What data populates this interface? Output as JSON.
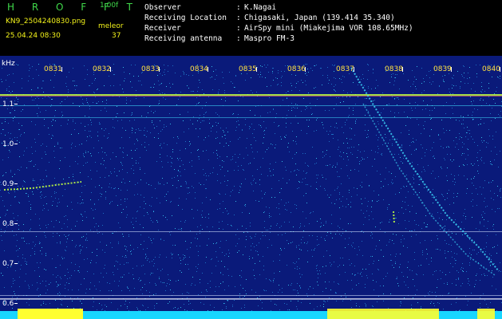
{
  "header": {
    "app_name": "H R O F F T",
    "version": "1.00f",
    "filename": "KN9_2504240830.png",
    "mode": "meleor",
    "datetime": "25.04.24 08:30",
    "count": "37"
  },
  "info": [
    {
      "label": "Observer",
      "value": "K.Nagai"
    },
    {
      "label": "Receiving Location",
      "value": "Chigasaki, Japan (139.414 35.340)"
    },
    {
      "label": "Receiver",
      "value": "AirSpy mini (Miakejima VOR 108.65MHz)"
    },
    {
      "label": "Receiving antenna",
      "value": "Maspro FM-3"
    }
  ],
  "spectrogram": {
    "y_unit": "kHz",
    "y_ticks": [
      "1.1",
      "1.0",
      "0.9",
      "0.8",
      "0.7",
      "0.6"
    ],
    "x_ticks": [
      "0831",
      "0832",
      "0833",
      "0834",
      "0835",
      "0836",
      "0837",
      "0838",
      "0839",
      "0840"
    ],
    "colors": {
      "background": "#0a1a7a",
      "noise": "#3fe0ff",
      "carrier": "#c0ff40",
      "signal": "#ffff30"
    }
  }
}
